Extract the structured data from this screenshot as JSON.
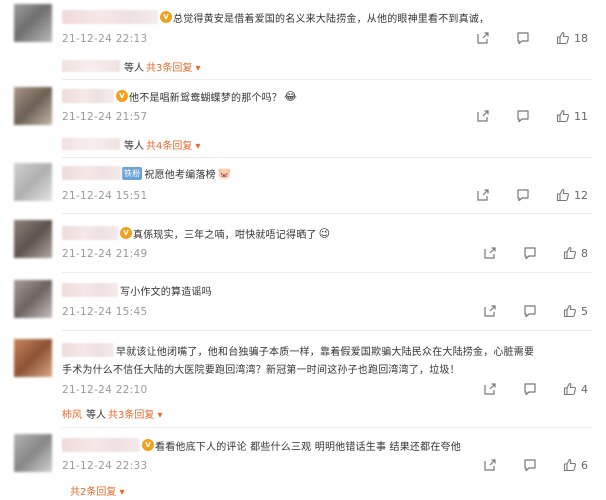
{
  "comments": [
    {
      "text": "总觉得黄安是借着爱国的名义来大陆捞金，从他的眼神里看不到真诚，",
      "badge": "V",
      "time": "21-12-24 22:13",
      "likes": "18",
      "replies_prefix": "等人",
      "replies_link": "共3条回复 ▾"
    },
    {
      "text": "他不是唱新鸳鸯蝴蝶梦的那个吗？",
      "emoji": "😂",
      "badge": "V",
      "time": "21-12-24 21:57",
      "likes": "11",
      "replies_prefix": "等人",
      "replies_link": "共4条回复 ▾"
    },
    {
      "text": "祝愿他考编落榜",
      "emoji": "🐷",
      "tag": "铁粉",
      "time": "21-12-24 15:51",
      "likes": "12"
    },
    {
      "text": "真係现实，三年之喃，咁快就唔记得晒了",
      "emoji": "😉",
      "badge": "V",
      "time": "21-12-24 21:49",
      "likes": "8"
    },
    {
      "text": "写小作文的算造谣吗",
      "time": "21-12-24 15:45",
      "likes": "5"
    },
    {
      "text_line1": "早就该让他闭嘴了，他和台独骗子本质一样，靠着假爱国欺骗大陆民众在大陆捞金，心脏需要",
      "text_line2": "手术为什么不信任大陆的大医院要跑回湾湾？新冠第一时间这孙子也跑回湾湾了，垃圾！",
      "time": "21-12-24 22:10",
      "likes": "4",
      "replies_name": "柿风",
      "replies_prefix": "等人",
      "replies_link": "共3条回复 ▾"
    },
    {
      "text": "看看他底下人的评论 都些什么三观 明明他错话生事 结果还都在夸他",
      "badge": "V",
      "time": "21-12-24 22:33",
      "likes": "6",
      "replies_link": "共2条回复 ▾"
    }
  ]
}
